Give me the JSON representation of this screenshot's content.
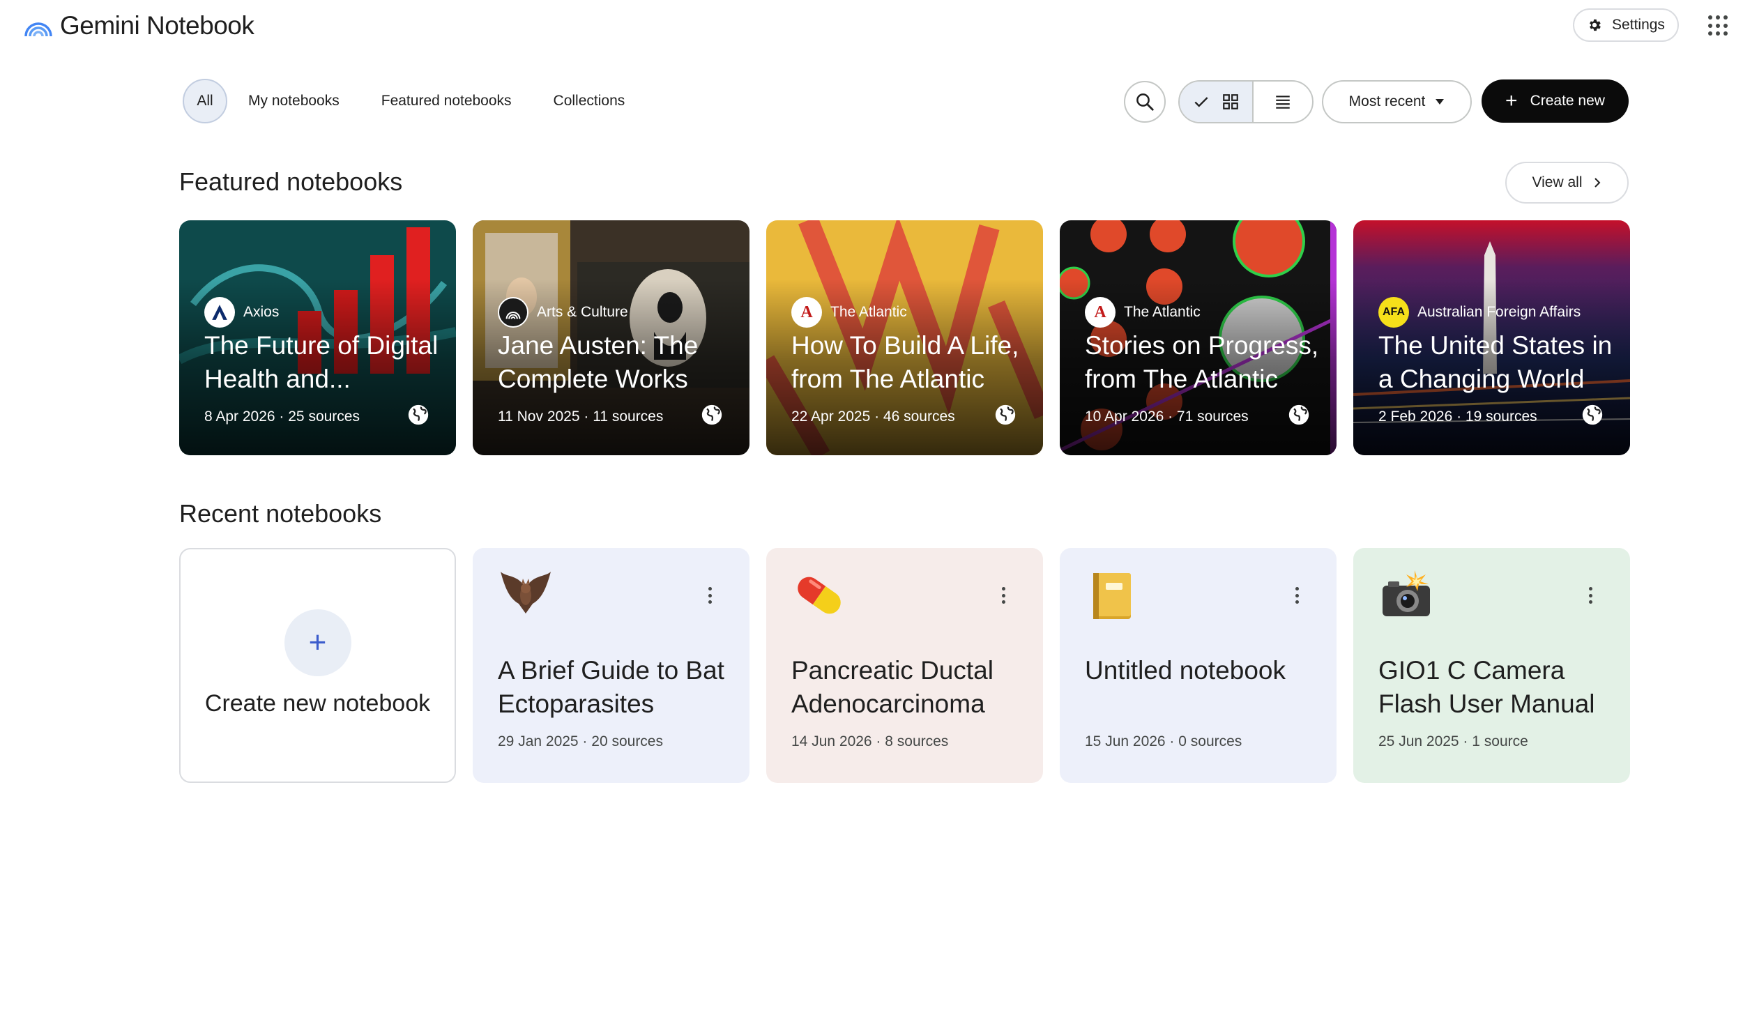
{
  "app": {
    "title": "Gemini Notebook"
  },
  "header": {
    "settings_label": "Settings",
    "settings_icon": "gear-icon",
    "apps_icon": "grid-dots-icon"
  },
  "filters": {
    "chips": [
      {
        "label": "All",
        "selected": true
      },
      {
        "label": "My notebooks",
        "selected": false
      },
      {
        "label": "Featured notebooks",
        "selected": false
      },
      {
        "label": "Collections",
        "selected": false
      }
    ]
  },
  "toolbar": {
    "search_icon": "search-icon",
    "view_mode": "grid",
    "sort_label": "Most recent",
    "create_label": "Create new"
  },
  "featured": {
    "title": "Featured notebooks",
    "view_all_label": "View all",
    "cards": [
      {
        "publisher": "Axios",
        "title": "The Future of Digital Health and...",
        "meta": "8 Apr 2026 · 25 sources",
        "bg": "#0d4d4a"
      },
      {
        "publisher": "Arts & Culture",
        "title": "Jane Austen: The Complete Works",
        "meta": "11 Nov 2025 · 11 sources",
        "bg": "#3a3128"
      },
      {
        "publisher": "The Atlantic",
        "title": "How To Build A Life, from The Atlantic",
        "meta": "22 Apr 2025 · 46 sources",
        "bg": "#e8b83a"
      },
      {
        "publisher": "The Atlantic",
        "title": "Stories on Progress, from The Atlantic",
        "meta": "10 Apr 2026 · 71 sources",
        "bg": "#151515"
      },
      {
        "publisher": "Australian Foreign Affairs",
        "title": "The United States in a Changing World",
        "meta": "2 Feb 2026 · 19 sources",
        "bg": "#1e2450"
      }
    ]
  },
  "recent": {
    "title": "Recent notebooks",
    "create_new_label": "Create new notebook",
    "cards": [
      {
        "emoji": "bat-icon",
        "title": "A Brief Guide to Bat Ectoparasites",
        "meta": "29 Jan 2025 · 20 sources",
        "bg": "#edf0fa"
      },
      {
        "emoji": "pill-icon",
        "title": "Pancreatic Ductal Adenocarcinoma",
        "meta": "14 Jun 2026 · 8 sources",
        "bg": "#f6ecea"
      },
      {
        "emoji": "notebook-icon",
        "title": "Untitled notebook",
        "meta": "15 Jun 2026 · 0 sources",
        "bg": "#edf0fa"
      },
      {
        "emoji": "camera-flash-icon",
        "title": "GIO1 C Camera Flash User Manual",
        "meta": "25 Jun 2025 · 1 source",
        "bg": "#e3f1e6"
      }
    ]
  }
}
